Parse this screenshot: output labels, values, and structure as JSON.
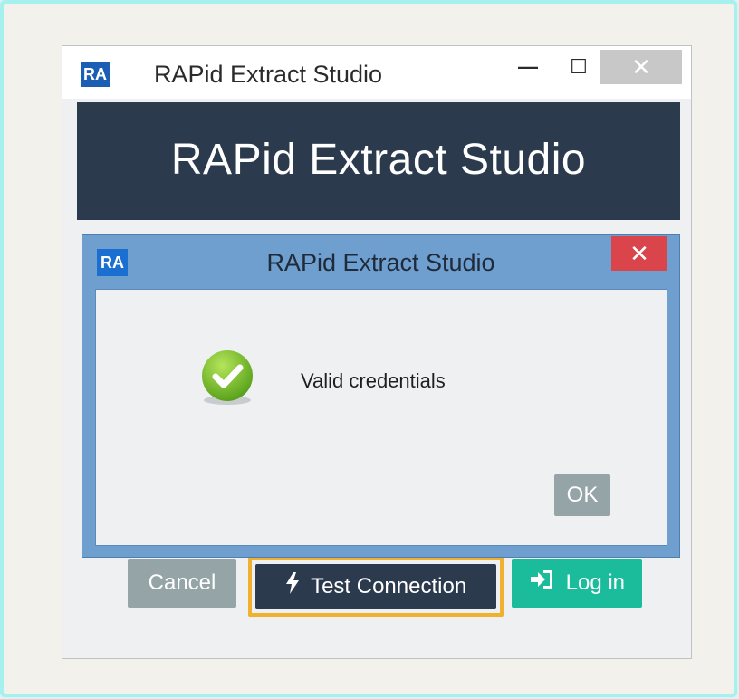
{
  "main_window": {
    "icon_text": "RA",
    "title": "RAPid Extract Studio",
    "minimize_glyph": "—",
    "maximize_glyph": "☐",
    "close_glyph": "✕",
    "banner_title": "RAPid Extract Studio"
  },
  "dialog": {
    "icon_text": "RA",
    "title": "RAPid Extract Studio",
    "close_glyph": "✕",
    "message": "Valid credentials",
    "ok_label": "OK",
    "status_icon": "success-check-icon"
  },
  "actions": {
    "cancel_label": "Cancel",
    "test_connection_label": "Test Connection",
    "login_label": "Log in"
  },
  "colors": {
    "banner": "#2c3a4e",
    "dialog_frame": "#6f9fcf",
    "login_button": "#1bbc9b",
    "cancel_button": "#95a4a6",
    "focus_ring": "#f0b030",
    "dialog_close": "#d9454b"
  }
}
